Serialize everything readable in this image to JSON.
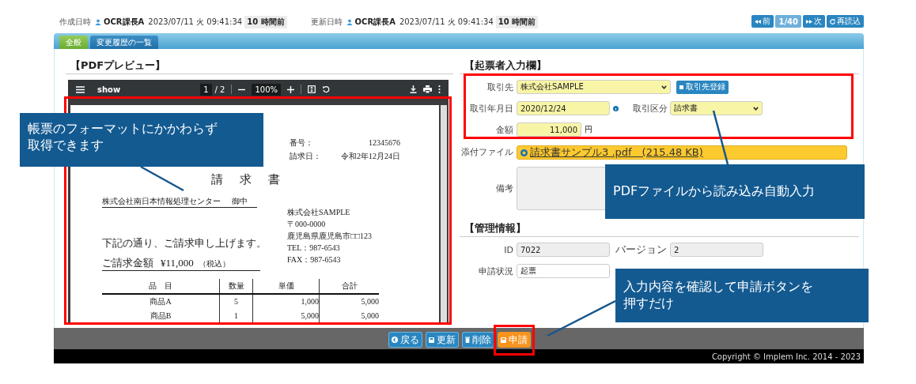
{
  "meta": [
    {
      "label": "作成日時",
      "user": "OCR課長A",
      "datetime": "2023/07/11 火 09:41:34",
      "ago": "10 時間前"
    },
    {
      "label": "更新日時",
      "user": "OCR課長A",
      "datetime": "2023/07/11 火 09:41:34",
      "ago": "10 時間前"
    }
  ],
  "nav": {
    "prev": "前",
    "page": "1/40",
    "next": "次",
    "reload": "再読込"
  },
  "tabs": [
    {
      "label": "全般",
      "selected": true
    },
    {
      "label": "変更履歴の一覧",
      "selected": false
    }
  ],
  "pdf": {
    "title": "【PDFプレビュー】",
    "filename": "show",
    "page": "1",
    "page_total": "/ 2",
    "zoom": "100%",
    "document": {
      "number_label": "番号：",
      "number": "12345676",
      "date_label": "請求日：",
      "date": "令和2年12月24日",
      "title": "請　求　書",
      "recipient": "株式会社南日本情報処理センター",
      "honorific": "御中",
      "sender": [
        "株式会社SAMPLE",
        "〒000-0000",
        "鹿児島県鹿児島市□□123",
        "TEL：987-6543",
        "FAX：987-6543"
      ],
      "message": "下記の通り、ご請求申し上げます。",
      "amount_label": "ご請求金額",
      "amount": "¥11,000",
      "tax": "（税込）",
      "columns": [
        "品　目",
        "数量",
        "単価",
        "合計"
      ],
      "rows": [
        [
          "商品A",
          "5",
          "1,000",
          "5,000"
        ],
        [
          "商品B",
          "1",
          "5,000",
          "5,000"
        ]
      ]
    }
  },
  "entry": {
    "title": "【起票者入力欄】",
    "rows": [
      [
        {
          "label": "取引先",
          "kind": "select",
          "value": "株式会社SAMPLE",
          "button": "取引先登録"
        }
      ],
      [
        {
          "label": "取引年月日",
          "kind": "date",
          "value": "2020/12/24"
        },
        {
          "label": "取引区分",
          "kind": "select",
          "value": "請求書"
        }
      ],
      [
        {
          "label": "金額",
          "kind": "number",
          "value": "11,000",
          "unit": "円"
        }
      ],
      [
        {
          "label": "添付ファイル",
          "kind": "file",
          "value": "請求書サンプル3 .pdf　(215.48 KB)"
        }
      ],
      [
        {
          "label": "備考",
          "kind": "textarea"
        }
      ]
    ]
  },
  "management": {
    "title": "【管理情報】",
    "rows": [
      [
        {
          "label": "ID",
          "value": "7022",
          "readonly": true
        },
        {
          "label": "バージョン",
          "value": "2",
          "readonly": true
        }
      ],
      [
        {
          "label": "申請状況",
          "value": "起票",
          "readonly": false
        }
      ]
    ]
  },
  "actions": [
    {
      "label": "戻る",
      "kind": "back"
    },
    {
      "label": "更新",
      "kind": "save"
    },
    {
      "label": "削除",
      "kind": "delete"
    },
    {
      "label": "申請",
      "kind": "apply"
    }
  ],
  "copyright": "Copyright © Implem Inc. 2014 - 2023",
  "callouts": [
    {
      "lines": [
        "帳票のフォーマットにかかわらず",
        "取得できます"
      ]
    },
    {
      "lines": [
        "PDFファイルから読み込み自動入力"
      ]
    },
    {
      "lines": [
        "入力内容を確認して申請ボタンを",
        "押すだけ"
      ]
    }
  ]
}
